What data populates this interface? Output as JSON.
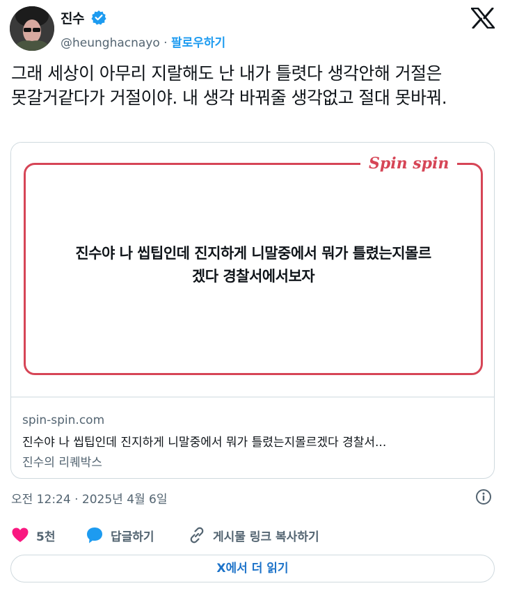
{
  "author": {
    "name": "진수",
    "handle": "@heunghacnayo",
    "separator": "·",
    "follow_label": "팔로우하기"
  },
  "tweet": {
    "text": "그래 세상이 아무리 지랄해도 난 내가 틀렷다 생각안해 거절은 못갈거같다가 거절이야. 내 생각 바꿔줄 생각없고 절대 못바꿔."
  },
  "card": {
    "brand": "Spin spin",
    "headline_line1": "진수야 나 씹팁인데 진지하게 니말중에서 뭐가 틀렸는지몰르",
    "headline_line2": "겠다 경찰서에서보자",
    "domain": "spin-spin.com",
    "description": "진수야 나 씹팁인데 진지하게 니말중에서 뭐가 틀렸는지몰르겠다 경찰서...",
    "subtitle": "진수의 리퀘박스"
  },
  "meta": {
    "timestamp": "오전 12:24 · 2025년 4월 6일"
  },
  "actions": {
    "likes": "5천",
    "reply": "답글하기",
    "copy_link": "게시물 링크 복사하기",
    "read_more": "X에서 더 읽기"
  },
  "colors": {
    "accent": "#1d9bf0",
    "like": "#f91880",
    "brand": "#d64556",
    "muted": "#536471"
  },
  "icons": [
    "avatar-image",
    "verified-badge-icon",
    "x-logo-icon",
    "info-icon",
    "heart-icon",
    "reply-bubble-icon",
    "link-icon"
  ]
}
